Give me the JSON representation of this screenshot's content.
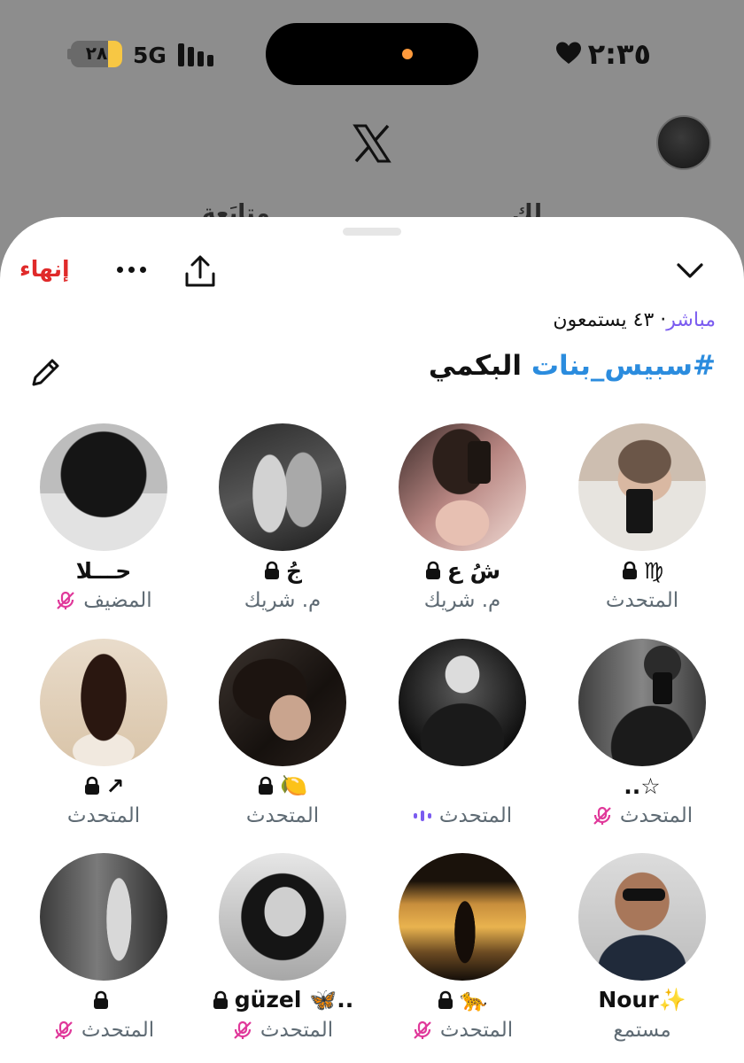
{
  "status_bar": {
    "time": "٢:٣٥",
    "network": "5G",
    "battery": "٢٨"
  },
  "background_app": {
    "tabs": [
      "لك",
      "متابَعة"
    ]
  },
  "space": {
    "end_label": "إنهاء",
    "live_label": "مباشر",
    "listeners": "٤٣ يستمعون",
    "hashtag": "#سبيس_بنات",
    "title_rest": "البكمي",
    "participants": [
      {
        "name": "♍",
        "role": "المتحدث",
        "lock": true,
        "mic": "none"
      },
      {
        "name": "شُ ع",
        "role": "م. شريك",
        "lock": true,
        "mic": "none"
      },
      {
        "name": "جُ",
        "role": "م. شريك",
        "lock": true,
        "mic": "none"
      },
      {
        "name": "حـــلا",
        "role": "المضيف",
        "lock": false,
        "mic": "muted"
      },
      {
        "name": "..☆",
        "role": "المتحدث",
        "lock": false,
        "mic": "muted"
      },
      {
        "name": "",
        "role": "المتحدث",
        "lock": false,
        "mic": "speaking"
      },
      {
        "name": "🍋",
        "role": "المتحدث",
        "lock": true,
        "mic": "none"
      },
      {
        "name": "↗",
        "role": "المتحدث",
        "lock": true,
        "mic": "none"
      },
      {
        "name": "Nour✨",
        "role": "مستمع",
        "lock": false,
        "mic": "none"
      },
      {
        "name": "🐆",
        "role": "المتحدث",
        "lock": true,
        "mic": "muted"
      },
      {
        "name": "güzel 🦋..",
        "role": "المتحدث",
        "lock": true,
        "mic": "muted"
      },
      {
        "name": "",
        "role": "المتحدث",
        "lock": true,
        "mic": "muted"
      }
    ]
  },
  "colors": {
    "accent_purple": "#7b5cf0",
    "hashtag_blue": "#2b8cde",
    "end_red": "#e02a2a",
    "muted_pink": "#e0389a"
  }
}
